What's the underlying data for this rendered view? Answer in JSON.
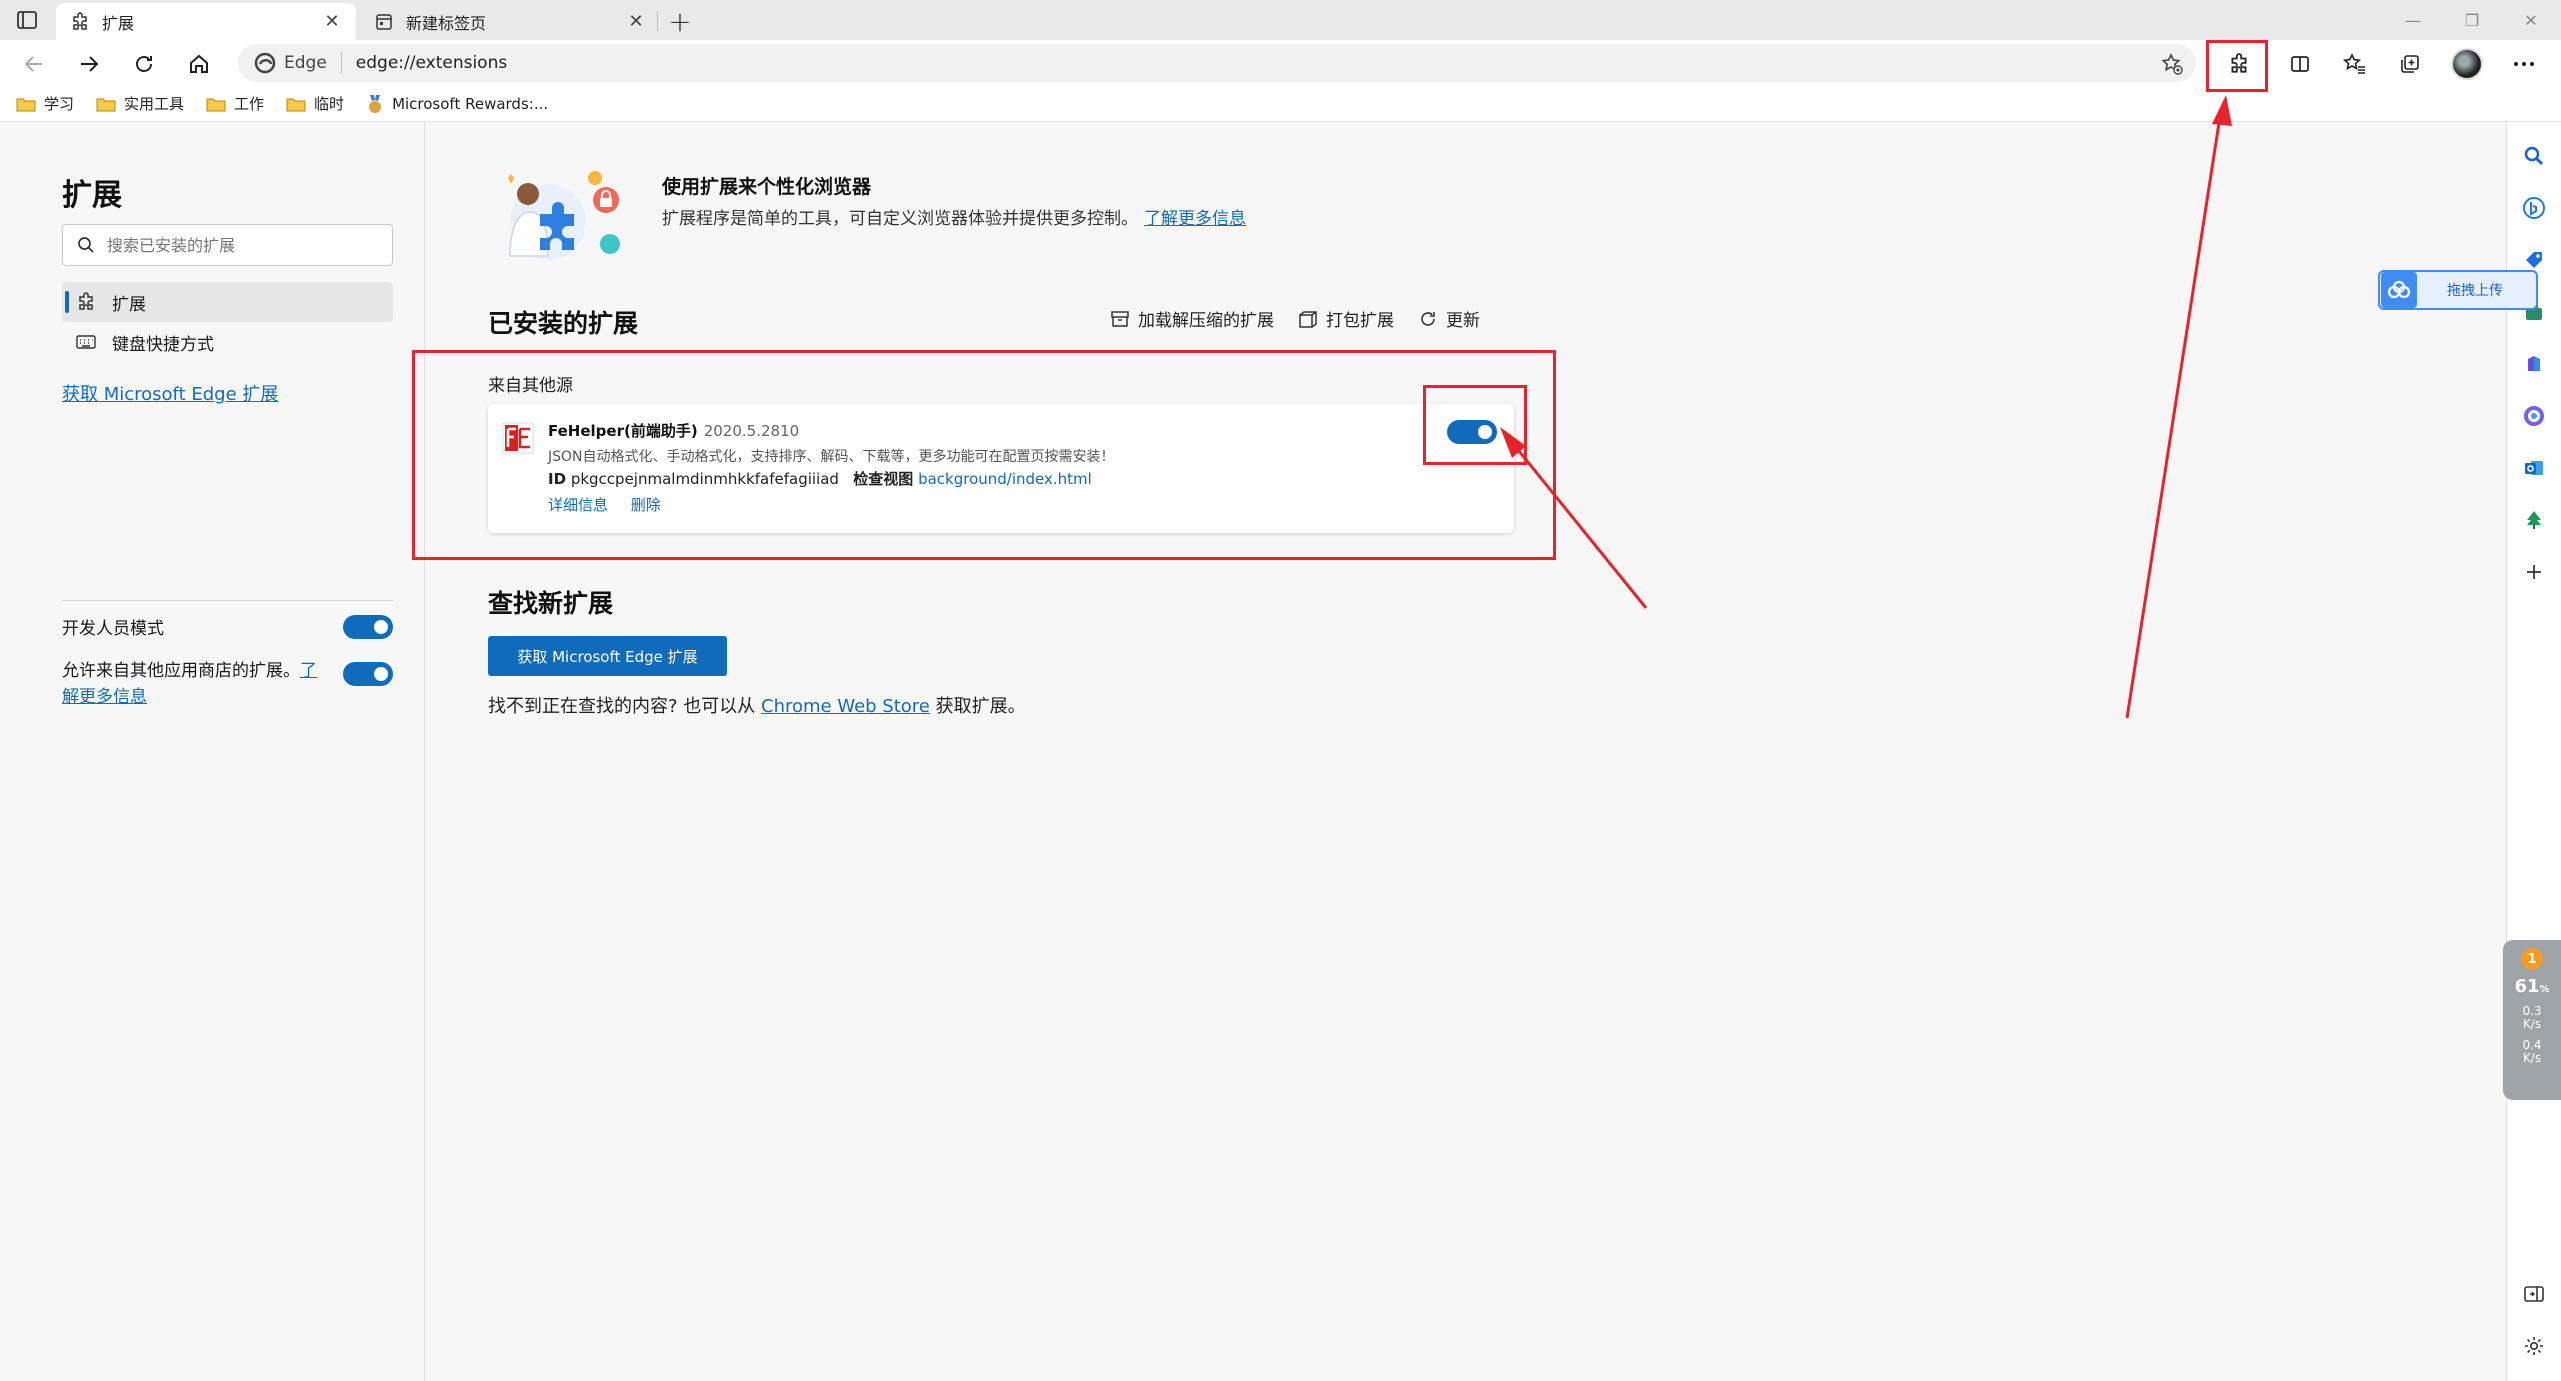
{
  "tabs": [
    {
      "title": "扩展",
      "active": true
    },
    {
      "title": "新建标签页",
      "active": false
    }
  ],
  "address_bar": {
    "brand": "Edge",
    "url": "edge://extensions"
  },
  "favorites": [
    "学习",
    "实用工具",
    "工作",
    "临时",
    "Microsoft Rewards:..."
  ],
  "sidebar": {
    "title": "扩展",
    "search_placeholder": "搜索已安装的扩展",
    "items": [
      {
        "label": "扩展",
        "selected": true
      },
      {
        "label": "键盘快捷方式",
        "selected": false
      }
    ],
    "get_link": "获取 Microsoft Edge 扩展",
    "developer_mode": {
      "label": "开发人员模式",
      "enabled": true
    },
    "allow_other_stores": {
      "label": "允许来自其他应用商店的扩展。",
      "link": "了解更多信息",
      "enabled": true
    }
  },
  "hero": {
    "title": "使用扩展来个性化浏览器",
    "description": "扩展程序是简单的工具，可自定义浏览器体验并提供更多控制。",
    "link": "了解更多信息"
  },
  "installed": {
    "title": "已安装的扩展",
    "actions": [
      "加载解压缩的扩展",
      "打包扩展",
      "更新"
    ],
    "source_label": "来自其他源",
    "extension": {
      "name": "FeHelper(前端助手)",
      "version": "2020.5.2810",
      "description": "JSON自动格式化、手动格式化，支持排序、解码、下载等，更多功能可在配置页按需安装！",
      "id_label": "ID",
      "id": "pkgccpejnmalmdinmhkkfafefagiiiad",
      "inspect_label": "检查视图",
      "inspect_link": "background/index.html",
      "details_link": "详细信息",
      "remove_link": "删除",
      "enabled": true
    }
  },
  "find_new": {
    "title": "查找新扩展",
    "button": "获取 Microsoft Edge 扩展",
    "text_before": "找不到正在查找的内容? 也可以从",
    "store_link": "Chrome Web Store",
    "text_after": "获取扩展。"
  },
  "upload_widget": {
    "label": "拖拽上传"
  },
  "speed_widget": {
    "badge": "1",
    "percent": "61",
    "up": "0.3",
    "down": "0.4",
    "unit": "K/s"
  },
  "colors": {
    "accent": "#0f6cbd",
    "annotation": "#e8232b"
  }
}
